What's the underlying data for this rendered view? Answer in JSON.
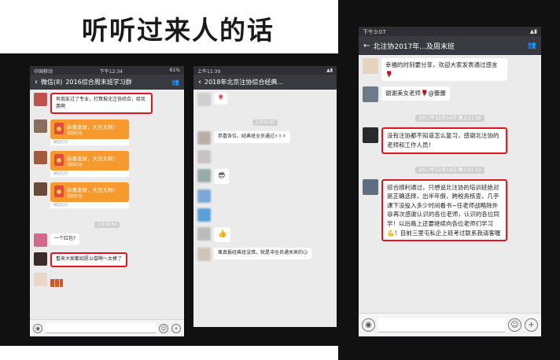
{
  "headline": "听听过来人的话",
  "phone1": {
    "status_left": "中国移动",
    "status_time": "下午12:34",
    "status_right": "61%",
    "back_label": "微信(8)",
    "title": "2016综合周末班学习群",
    "messages": [
      {
        "text": "有朋友过了专业，打算报北注协综合，给优惠啊",
        "highlight": true
      },
      {
        "packet_title": "恭喜发财，大吉大利！",
        "packet_sub": "领取红包",
        "packet_foot": "微信红包"
      },
      {
        "packet_title": "恭喜发财，大吉大利！",
        "packet_sub": "领取红包",
        "packet_foot": "微信红包"
      },
      {
        "packet_title": "恭喜发财，大吉大利！",
        "packet_sub": "领取红包",
        "packet_foot": "微信红包"
      }
    ],
    "timestamp": "上午10:54",
    "msg_after_1": "一个红包?",
    "msg_after_2": "看来大家都如愿以偿啊～太棒了",
    "msg_after_2_highlight": true
  },
  "phone2": {
    "status_time": "上午11:39",
    "title": "2018年北京注协综合经典...",
    "timestamp": "上午11:37",
    "msg_congrats": "恭喜各位，经典班全员通过✌✌✌",
    "msg_last": "果真报经典班没错，就是冲全员通关来的😏"
  },
  "phone3": {
    "status_time": "下午3:07",
    "title": "北注协2017年...及周末班",
    "msg_top": "幸福的时刻要分享，欢迎大家发表通过感言🌹",
    "msg_thanks": "谢谢美女老师🌹@蕾蕾",
    "timestamp_1": "2017年12月14日 晚上21:50",
    "msg_red_1": "没有注协都不知道怎么复习，感谢北注协的老师和工作人员！",
    "timestamp_2": "2017年12月14日 晚上21:51",
    "msg_red_2": "综合顺利通过，只想说北注协的培训班绝对是正确选择，出半年假，跨税务核查，几乎课下没投入多少时间看书~任老师战略除外😄再次感谢认识的各位老师，认识的各位同学！以后路上还要继续向各位老师们学习💪！目前三里屯私企上班考过联系我请客喔"
  },
  "colors": {
    "titlebar": "#393a3f",
    "chat_bg": "#ebebeb",
    "highlight": "#e0161f",
    "packet": "#f79a2d"
  }
}
